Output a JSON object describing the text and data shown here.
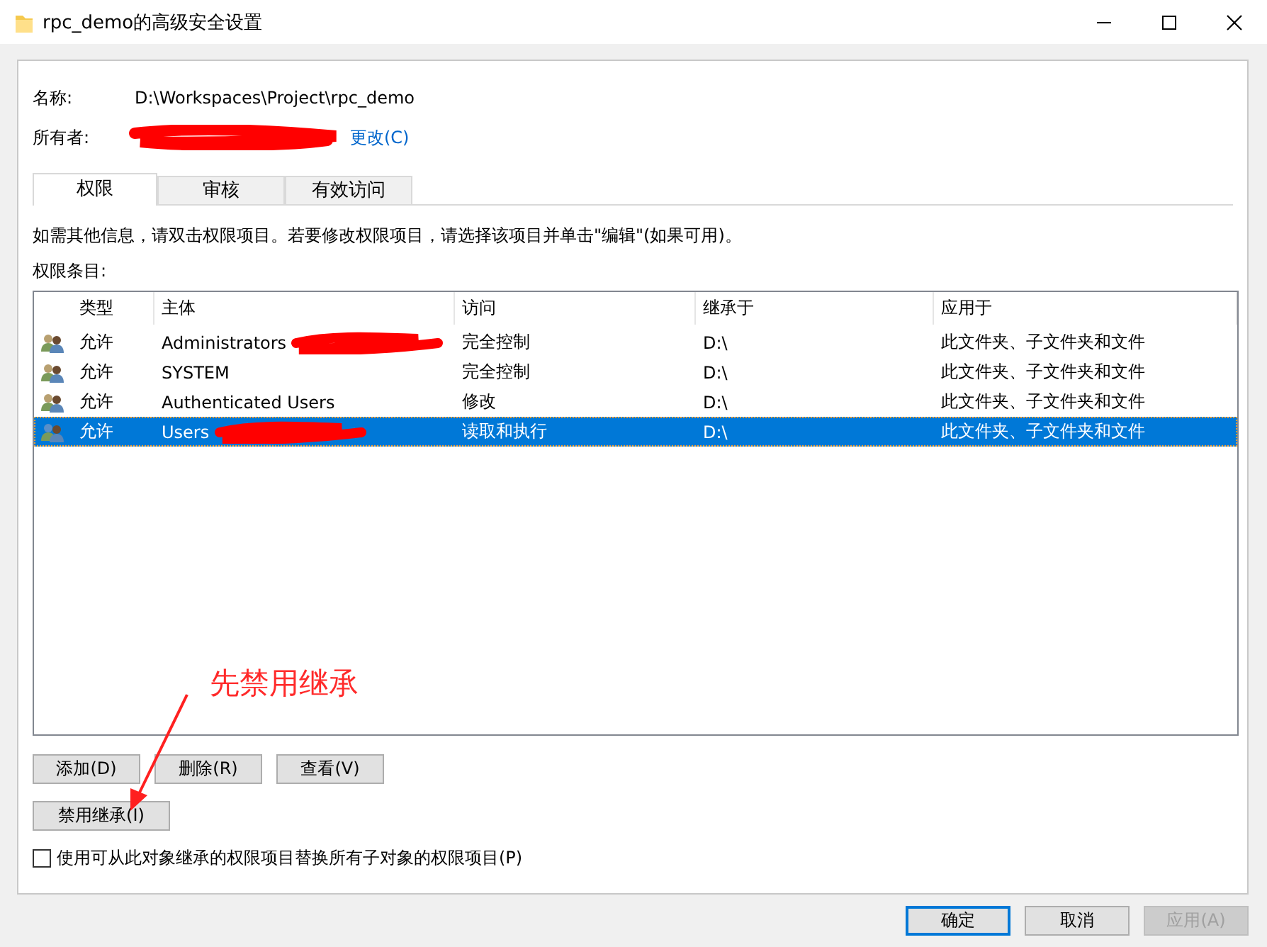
{
  "window": {
    "title": "rpc_demo的高级安全设置"
  },
  "name_label": "名称:",
  "name_value": "D:\\Workspaces\\Project\\rpc_demo",
  "owner_label": "所有者:",
  "owner_redacted": true,
  "owner_link": "更改(C)",
  "tabs": [
    {
      "label": "权限",
      "selected": true
    },
    {
      "label": "审核",
      "selected": false
    },
    {
      "label": "有效访问",
      "selected": false
    }
  ],
  "info_text": "如需其他信息，请双击权限项目。若要修改权限项目，请选择该项目并单击\"编辑\"(如果可用)。",
  "list_label": "权限条目:",
  "table": {
    "columns": [
      "类型",
      "主体",
      "访问",
      "继承于",
      "应用于"
    ],
    "rows": [
      {
        "type": "允许",
        "principal": "Administrators",
        "redacted": true,
        "access": "完全控制",
        "inherited_from": "D:\\",
        "applies_to": "此文件夹、子文件夹和文件",
        "selected": false
      },
      {
        "type": "允许",
        "principal": "SYSTEM",
        "redacted": false,
        "access": "完全控制",
        "inherited_from": "D:\\",
        "applies_to": "此文件夹、子文件夹和文件",
        "selected": false
      },
      {
        "type": "允许",
        "principal": "Authenticated Users",
        "redacted": false,
        "access": "修改",
        "inherited_from": "D:\\",
        "applies_to": "此文件夹、子文件夹和文件",
        "selected": false
      },
      {
        "type": "允许",
        "principal": "Users",
        "redacted": true,
        "access": "读取和执行",
        "inherited_from": "D:\\",
        "applies_to": "此文件夹、子文件夹和文件",
        "selected": true
      }
    ]
  },
  "row_buttons": [
    "添加(D)",
    "删除(R)",
    "查看(V)"
  ],
  "inherit_button": "禁用继承(I)",
  "replace_checkbox": {
    "label": "使用可从此对象继承的权限项目替换所有子对象的权限项目(P)",
    "checked": false
  },
  "annotation": {
    "text": "先禁用继承"
  },
  "dialog_buttons": [
    {
      "label": "确定",
      "default": true,
      "disabled": false
    },
    {
      "label": "取消",
      "default": false,
      "disabled": false
    },
    {
      "label": "应用(A)",
      "default": false,
      "disabled": true
    }
  ]
}
